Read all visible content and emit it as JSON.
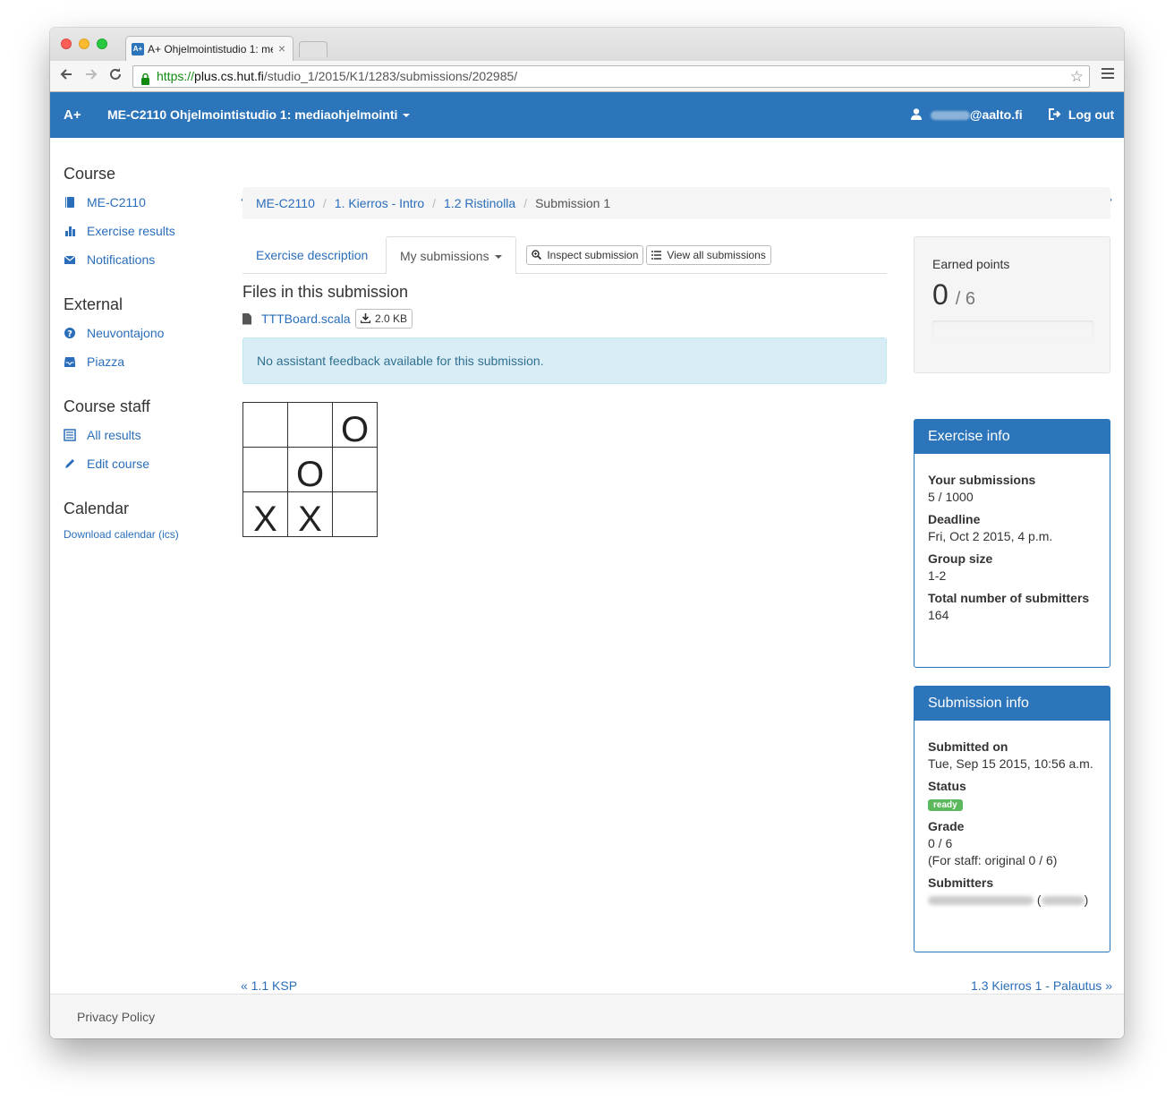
{
  "browser": {
    "tab_title": "A+ Ohjelmointistudio 1: me",
    "tab_close": "×",
    "favicon": "A+",
    "url_scheme": "https://",
    "url_host": "plus.cs.hut.fi",
    "url_path": "/studio_1/2015/K1/1283/submissions/202985/",
    "star_icon": "☆"
  },
  "navbar": {
    "brand": "A+",
    "course_title": "ME-C2110 Ohjelmointistudio 1: mediaohjelmointi",
    "user_email_suffix": "@aalto.fi",
    "logout": "Log out"
  },
  "sidebar": {
    "course_heading": "Course",
    "course_items": [
      {
        "label": "ME-C2110",
        "icon": "book-icon"
      },
      {
        "label": "Exercise results",
        "icon": "bar-chart-icon"
      },
      {
        "label": "Notifications",
        "icon": "envelope-icon"
      }
    ],
    "external_heading": "External",
    "external_items": [
      {
        "label": "Neuvontajono",
        "icon": "question-icon"
      },
      {
        "label": "Piazza",
        "icon": "inbox-icon"
      }
    ],
    "staff_heading": "Course staff",
    "staff_items": [
      {
        "label": "All results",
        "icon": "list-icon"
      },
      {
        "label": "Edit course",
        "icon": "pencil-icon"
      }
    ],
    "calendar_heading": "Calendar",
    "calendar_link": "Download calendar (ics)"
  },
  "pager": {
    "prev": "« 1.1 KSP",
    "next": "1.3 Kierros 1 - Palautus »"
  },
  "breadcrumb": {
    "items": [
      "ME-C2110",
      "1. Kierros - Intro",
      "1.2 Ristinolla"
    ],
    "active": "Submission 1",
    "separator": "/"
  },
  "tabs": {
    "description": "Exercise description",
    "mine": "My submissions",
    "inspect": "Inspect submission",
    "view_all": "View all submissions"
  },
  "files": {
    "heading": "Files in this submission",
    "name": "TTTBoard.scala",
    "size": "2.0 KB"
  },
  "alert": "No assistant feedback available for this submission.",
  "board": [
    [
      "",
      "",
      "O"
    ],
    [
      "",
      "O",
      ""
    ],
    [
      "X",
      "X",
      ""
    ]
  ],
  "points": {
    "label": "Earned points",
    "earned": "0",
    "max": "/ 6",
    "progress_fraction": 0
  },
  "exercise_info": {
    "title": "Exercise info",
    "submissions_label": "Your submissions",
    "submissions_value": "5 / 1000",
    "deadline_label": "Deadline",
    "deadline_value": "Fri, Oct 2 2015, 4 p.m.",
    "group_label": "Group size",
    "group_value": "1-2",
    "total_label": "Total number of submitters",
    "total_value": "164"
  },
  "submission_info": {
    "title": "Submission info",
    "submitted_label": "Submitted on",
    "submitted_value": "Tue, Sep 15 2015, 10:56 a.m.",
    "status_label": "Status",
    "status_value": "ready",
    "grade_label": "Grade",
    "grade_value": "0 / 6",
    "grade_note": "(For staff: original 0 / 6)",
    "submitters_label": "Submitters"
  },
  "footer": {
    "privacy": "Privacy Policy"
  },
  "colors": {
    "brand_blue": "#2c75ba",
    "link": "#2a6ebb",
    "ready_green": "#5cb85c",
    "alert_bg": "#d9edf7"
  }
}
